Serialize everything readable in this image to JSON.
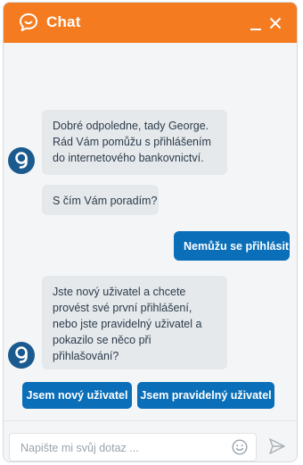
{
  "header": {
    "title": "Chat",
    "color": "#f47b20"
  },
  "messages": [
    {
      "sender": "bot",
      "lines": [
        "Dobré odpoledne, tady George.",
        "Rád Vám pomůžu s přihlášením",
        "do internetového bankovnictví."
      ]
    },
    {
      "sender": "bot",
      "lines": [
        "S čím Vám poradím?"
      ]
    },
    {
      "sender": "user",
      "lines": [
        "Nemůžu se přihlásit"
      ]
    },
    {
      "sender": "bot",
      "lines": [
        "Jste nový uživatel a chcete",
        "provést své první přihlášení,",
        "nebo jste pravidelný uživatel a",
        "pokazilo se něco při",
        "přihlašování?"
      ]
    }
  ],
  "options": [
    "Jsem nový uživatel",
    "Jsem pravidelný uživatel"
  ],
  "composer": {
    "placeholder": "Napište mi svůj dotaz ..."
  },
  "icons": {
    "header_chat": "chat-bubble-icon",
    "minimize": "minimize-icon",
    "close": "close-icon",
    "avatar": "george-avatar-icon",
    "emoji": "smiley-icon",
    "send": "send-icon"
  },
  "colors": {
    "accent": "#f47b20",
    "user_bubble": "#0a6eb8",
    "bot_bubble": "#e6e9ec",
    "avatar": "#1b5a8f"
  }
}
